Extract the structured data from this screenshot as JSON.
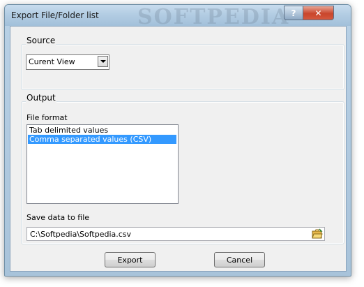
{
  "window": {
    "title": "Export File/Folder list",
    "watermark": "SOFTPEDIA",
    "help_glyph": "?",
    "close_glyph": "✕"
  },
  "source": {
    "group_label": "Source",
    "selected": "Curent View"
  },
  "output": {
    "group_label": "Output",
    "file_format_label": "File format",
    "formats": [
      {
        "label": "Tab delimited values",
        "selected": false
      },
      {
        "label": "Comma separated values (CSV)",
        "selected": true
      }
    ],
    "save_label": "Save data to file",
    "save_path": "C:\\Softpedia\\Softpedia.csv"
  },
  "buttons": {
    "export": "Export",
    "cancel": "Cancel"
  },
  "colors": {
    "selection": "#3399ff",
    "close_button": "#c9462c"
  }
}
